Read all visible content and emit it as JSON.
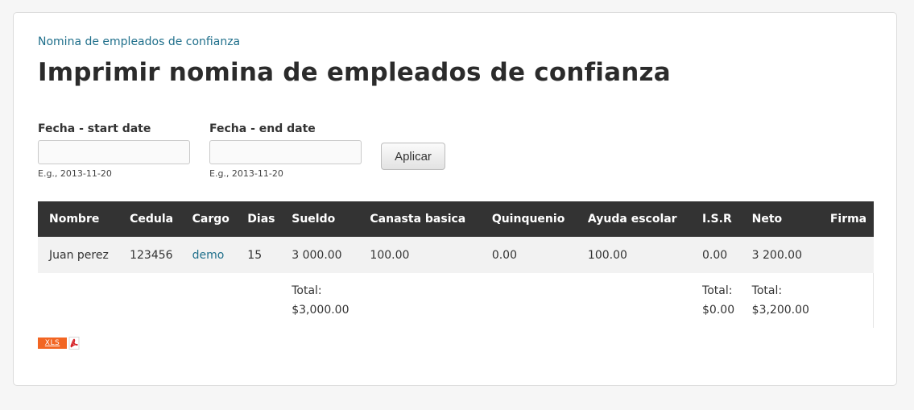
{
  "breadcrumb": "Nomina de empleados de confianza",
  "title": "Imprimir nomina de empleados de confianza",
  "filters": {
    "start": {
      "label": "Fecha - start date",
      "value": "",
      "hint": "E.g., 2013-11-20"
    },
    "end": {
      "label": "Fecha - end date",
      "value": "",
      "hint": "E.g., 2013-11-20"
    },
    "apply_label": "Aplicar"
  },
  "table": {
    "headers": [
      "Nombre",
      "Cedula",
      "Cargo",
      "Dias",
      "Sueldo",
      "Canasta basica",
      "Quinquenio",
      "Ayuda escolar",
      "I.S.R",
      "Neto",
      "Firma"
    ],
    "rows": [
      [
        "Juan perez",
        "123456",
        "demo",
        "15",
        "3 000.00",
        "100.00",
        "0.00",
        "100.00",
        "0.00",
        "3 200.00",
        ""
      ]
    ],
    "totals": {
      "label": "Total:",
      "sueldo": "$3,000.00",
      "isr": "$0.00",
      "neto": "$3,200.00"
    }
  },
  "exports": {
    "xls_label": "XLS",
    "pdf_icon": "pdf-icon"
  },
  "colors": {
    "header_bg": "#333333",
    "link": "#1f6f8b",
    "xls": "#f26522"
  }
}
